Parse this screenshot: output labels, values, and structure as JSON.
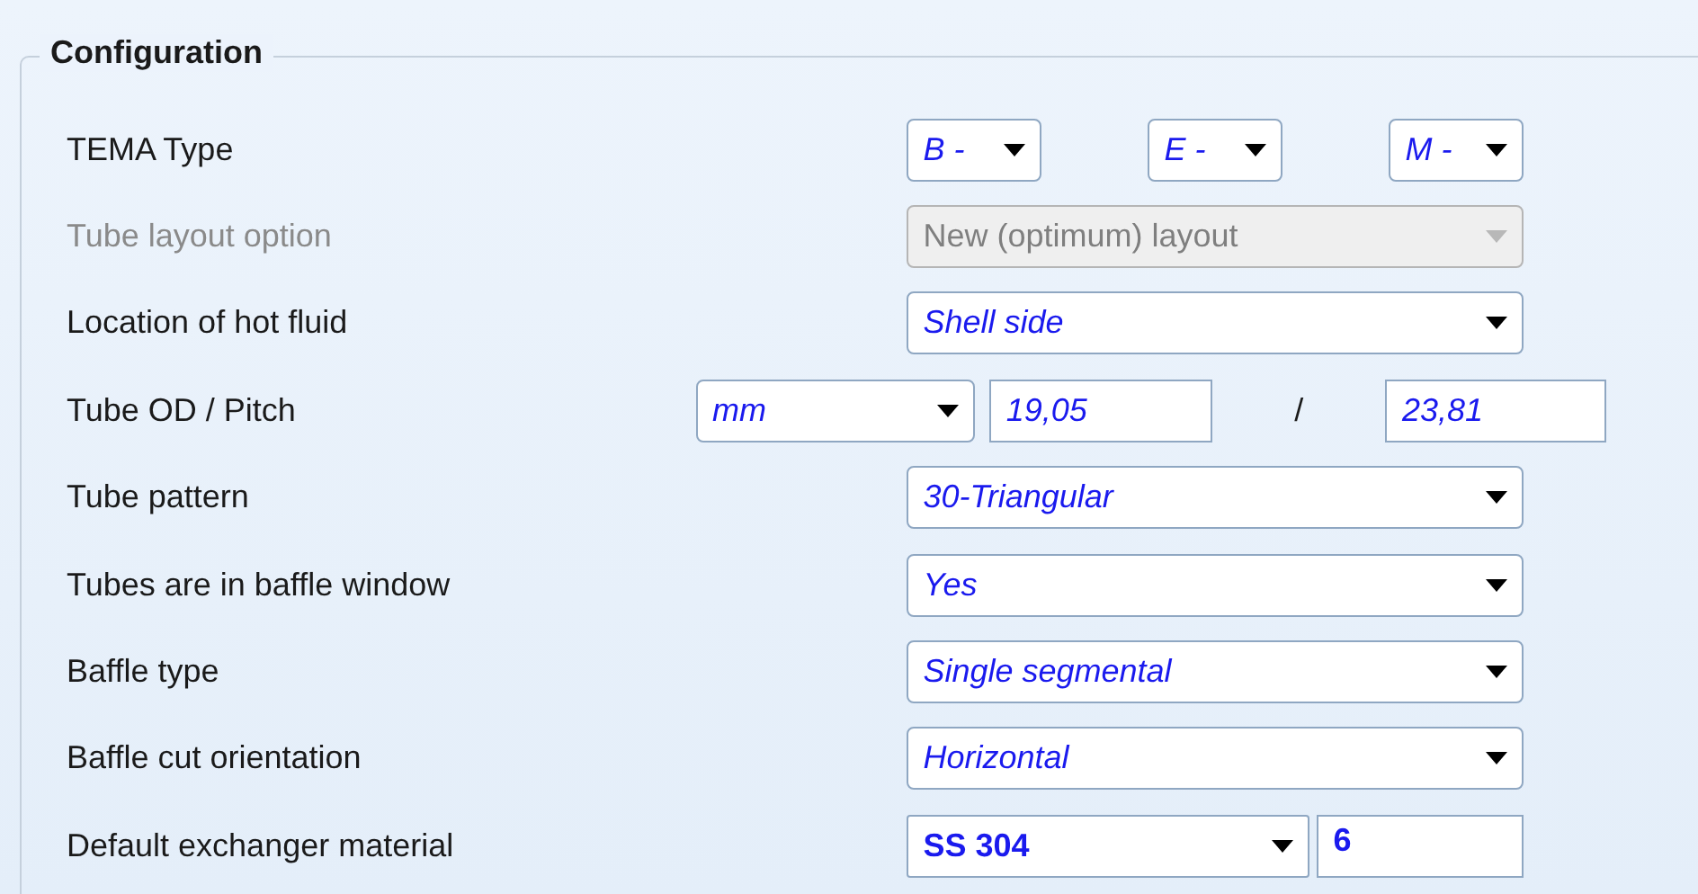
{
  "group": {
    "title": "Configuration"
  },
  "rows": [
    {
      "kind": "triple",
      "label": "TEMA Type",
      "disabled": false,
      "values": [
        "B -",
        "E -",
        "M -"
      ]
    },
    {
      "kind": "dropdown",
      "label": "Tube layout option",
      "disabled": true,
      "values": [
        "New (optimum) layout"
      ]
    },
    {
      "kind": "dropdown",
      "label": "Location of hot fluid",
      "disabled": false,
      "values": [
        "Shell side"
      ]
    },
    {
      "kind": "od_pitch",
      "label": "Tube OD / Pitch",
      "disabled": false,
      "values": [
        "mm",
        "19,05",
        "/",
        "23,81"
      ]
    },
    {
      "kind": "dropdown",
      "label": "Tube pattern",
      "disabled": false,
      "values": [
        "30-Triangular"
      ]
    },
    {
      "kind": "dropdown",
      "label": "Tubes are in baffle window",
      "disabled": false,
      "values": [
        "Yes"
      ]
    },
    {
      "kind": "dropdown",
      "label": "Baffle type",
      "disabled": false,
      "values": [
        "Single segmental"
      ]
    },
    {
      "kind": "dropdown",
      "label": "Baffle cut orientation",
      "disabled": false,
      "values": [
        "Horizontal"
      ]
    },
    {
      "kind": "material",
      "label": "Default exchanger material",
      "disabled": false,
      "values": [
        "SS 304",
        "6"
      ]
    }
  ]
}
